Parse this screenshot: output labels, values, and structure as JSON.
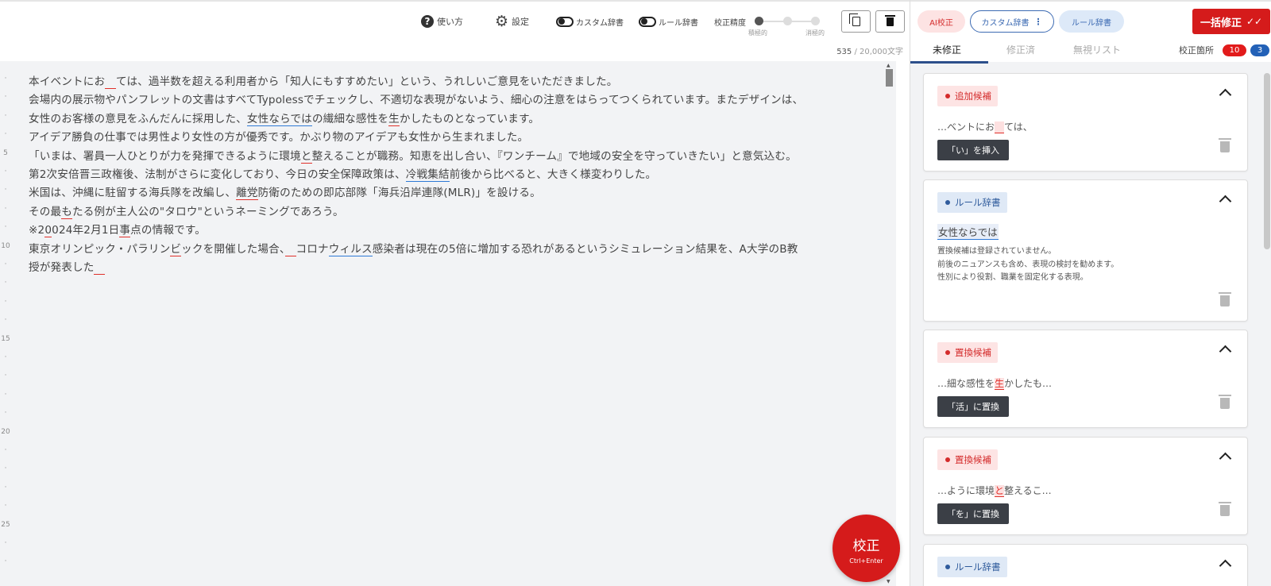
{
  "toolbar": {
    "help_label": "使い方",
    "settings_label": "設定",
    "custom_dict_label": "カスタム辞書",
    "rule_dict_label": "ルール辞書",
    "accuracy_label": "校正精度",
    "accuracy_low": "積極的",
    "accuracy_high": "消極的",
    "accuracy_level": "1 of 3",
    "char_count": "535",
    "char_max": " / 20,000文字"
  },
  "editor": {
    "lines": [
      {
        "num": "·",
        "segments": [
          {
            "t": "本イベントにお"
          },
          {
            "t": "　",
            "u": "red"
          },
          {
            "t": "ては、過半数を超える利用者から「知人にもすすめたい」という、うれしいご意見をいただきました。"
          }
        ]
      },
      {
        "num": "·",
        "segments": [
          {
            "t": "会場内の展示物やパンフレットの文書はすべてTypolessでチェックし、不適切な表現がないよう、細心の注意をはらってつくられています。またデザインは、"
          }
        ]
      },
      {
        "num": "·",
        "segments": [
          {
            "t": "女性のお客様の意見をふんだんに採用した、"
          },
          {
            "t": "女性ならでは",
            "u": "blue"
          },
          {
            "t": "の繊細な感性を"
          },
          {
            "t": "生",
            "u": "red"
          },
          {
            "t": "かしたものとなっています。"
          }
        ]
      },
      {
        "num": "·",
        "segments": [
          {
            "t": "アイデア勝負の仕事では男性より女性の方が優秀です。かぶり物のアイデアも女性から生まれました。"
          }
        ]
      },
      {
        "num": "5",
        "segments": [
          {
            "t": "「いまは、署員一人ひとりが力を発揮できるように環境"
          },
          {
            "t": "と",
            "u": "red"
          },
          {
            "t": "整えることが職務。知恵を出し合い、『ワンチーム』で地域の安全を守っていきたい」と意気込む。"
          }
        ]
      },
      {
        "num": "·",
        "segments": [
          {
            "t": "第2次安倍晋三政権後、法制がさらに変化しており、今日の安全保障政策は、"
          },
          {
            "t": "冷戦集結",
            "u": "blue"
          },
          {
            "t": "前後から比べると、大きく様変わりした。"
          }
        ]
      },
      {
        "num": "·",
        "segments": [
          {
            "t": "米国は、沖縄に駐留する海兵隊を改編し、"
          },
          {
            "t": "離党",
            "u": "red"
          },
          {
            "t": "防衛のための即応部隊「海兵沿岸連隊(MLR)」を設ける。"
          }
        ]
      },
      {
        "num": "·",
        "segments": [
          {
            "t": "その最"
          },
          {
            "t": "も",
            "u": "red"
          },
          {
            "t": "たる例が主人公の\"タロウ\"というネーミングであろう。"
          }
        ]
      },
      {
        "num": "·",
        "segments": [
          {
            "t": "※2"
          },
          {
            "t": "0",
            "u": "red"
          },
          {
            "t": "024年2月1日"
          },
          {
            "t": "事",
            "u": "red"
          },
          {
            "t": "点の情報です。"
          }
        ]
      },
      {
        "num": "10",
        "segments": [
          {
            "t": "東京オリンピック・パラリン"
          },
          {
            "t": "ビ",
            "u": "red"
          },
          {
            "t": "ックを開催した場合、"
          },
          {
            "t": "　",
            "u": "red"
          },
          {
            "t": "コロナ"
          },
          {
            "t": "ウィルス",
            "u": "blue"
          },
          {
            "t": "感染者は現在の5倍に増加する恐れがあるというシミュレーション結果を、A大学のB教"
          }
        ]
      },
      {
        "num": "·",
        "segments": [
          {
            "t": "授が発表した"
          },
          {
            "t": "　",
            "u": "red"
          }
        ]
      },
      {
        "num": "·",
        "segments": []
      },
      {
        "num": "·",
        "segments": []
      },
      {
        "num": "·",
        "segments": []
      },
      {
        "num": "15",
        "segments": []
      },
      {
        "num": "·",
        "segments": []
      },
      {
        "num": "·",
        "segments": []
      },
      {
        "num": "·",
        "segments": []
      },
      {
        "num": "·",
        "segments": []
      },
      {
        "num": "20",
        "segments": []
      },
      {
        "num": "·",
        "segments": []
      },
      {
        "num": "·",
        "segments": []
      },
      {
        "num": "·",
        "segments": []
      },
      {
        "num": "·",
        "segments": []
      },
      {
        "num": "25",
        "segments": []
      },
      {
        "num": "·",
        "segments": []
      },
      {
        "num": "·",
        "segments": []
      }
    ]
  },
  "fab": {
    "label": "校正",
    "shortcut": "Ctrl+Enter"
  },
  "panel": {
    "ai_pill": "AI校正",
    "custom_pill": "カスタム辞書",
    "custom_dots": "⋮",
    "rule_pill": "ルール辞書",
    "fix_all": "一括修正",
    "fix_all_icon": "✓✓",
    "tabs": [
      "未修正",
      "修正済",
      "無視リスト"
    ],
    "count_label": "校正箇所",
    "count_red": "10",
    "count_blue": "3"
  },
  "cards": [
    {
      "type": "red",
      "tag": "追加候補",
      "snippet_pre": "…ベントにお",
      "snippet_hl": "　",
      "snippet_post": "ては、",
      "action": "「い」を挿入"
    },
    {
      "type": "blue",
      "tag": "ルール辞書",
      "word": "女性ならでは",
      "notes": [
        "置換候補は登録されていません。",
        "前後のニュアンスも含め、表現の検討を勧めます。",
        "性別により役割、職業を固定化する表現。"
      ]
    },
    {
      "type": "red",
      "tag": "置換候補",
      "snippet_pre": "…細な感性を",
      "snippet_hl": "生",
      "snippet_post": "かしたも…",
      "action": "「活」に置換"
    },
    {
      "type": "red",
      "tag": "置換候補",
      "snippet_pre": "…ように環境",
      "snippet_hl": "と",
      "snippet_post": "整えるこ…",
      "action": "「を」に置換"
    },
    {
      "type": "blue",
      "tag": "ルール辞書"
    }
  ],
  "colors": {
    "accent_red": "#d51b1b",
    "accent_blue": "#2361b7",
    "dark_button": "#3b3f46"
  }
}
